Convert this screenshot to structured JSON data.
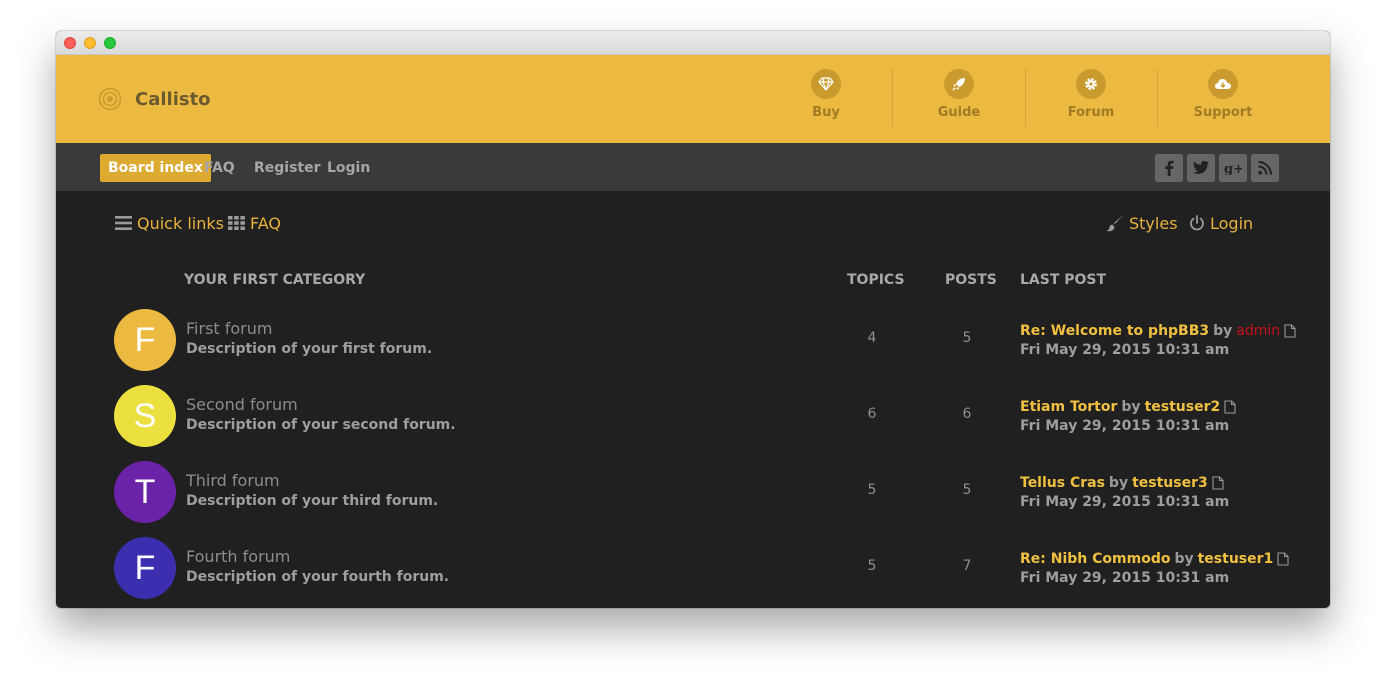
{
  "brand": {
    "name": "Callisto"
  },
  "topnav": [
    {
      "label": "Buy",
      "icon": "diamond-icon"
    },
    {
      "label": "Guide",
      "icon": "rocket-icon"
    },
    {
      "label": "Forum",
      "icon": "gear-icon"
    },
    {
      "label": "Support",
      "icon": "cloud-download-icon"
    }
  ],
  "subnav": {
    "tabs": [
      "Board index",
      "FAQ",
      "Register",
      "Login"
    ],
    "social": [
      "f",
      "t",
      "g+",
      "rss"
    ]
  },
  "toolbar": {
    "quick_links": "Quick links",
    "faq": "FAQ",
    "styles": "Styles",
    "login": "Login"
  },
  "category": {
    "title": "YOUR FIRST CATEGORY",
    "col_topics": "TOPICS",
    "col_posts": "POSTS",
    "col_last_post": "LAST POST"
  },
  "forums": [
    {
      "letter": "F",
      "color": "#ecba41",
      "title": "First forum",
      "desc": "Description of your first forum.",
      "topics": "4",
      "posts": "5",
      "last_title": "Re: Welcome to phpBB3",
      "by": "by",
      "last_user": "admin",
      "date": "Fri May 29, 2015 10:31 am"
    },
    {
      "letter": "S",
      "color": "#ece040",
      "title": "Second forum",
      "desc": "Description of your second forum.",
      "topics": "6",
      "posts": "6",
      "last_title": "Etiam Tortor",
      "by": "by",
      "last_user": "testuser2",
      "date": "Fri May 29, 2015 10:31 am"
    },
    {
      "letter": "T",
      "color": "#6a22a8",
      "title": "Third forum",
      "desc": "Description of your third forum.",
      "topics": "5",
      "posts": "5",
      "last_title": "Tellus Cras",
      "by": "by",
      "last_user": "testuser3",
      "date": "Fri May 29, 2015 10:31 am"
    },
    {
      "letter": "F",
      "color": "#3b2fb0",
      "title": "Fourth forum",
      "desc": "Description of your fourth forum.",
      "topics": "5",
      "posts": "7",
      "last_title": "Re: Nibh Commodo",
      "by": "by",
      "last_user": "testuser1",
      "date": "Fri May 29, 2015 10:31 am"
    }
  ],
  "colors": {
    "accent": "#ecba41",
    "link": "#f0c040",
    "admin": "#c8101a",
    "bg": "#202020"
  }
}
